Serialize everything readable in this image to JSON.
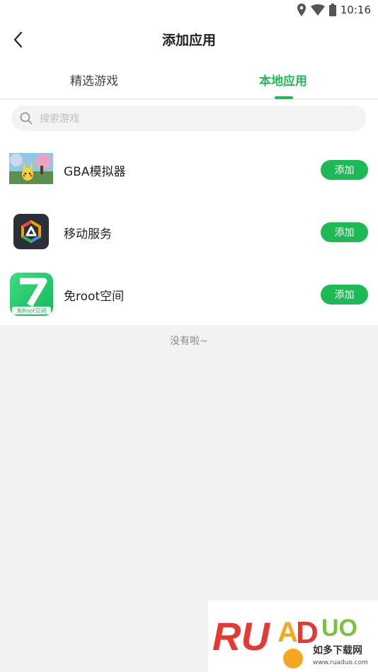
{
  "status_bar": {
    "time": "10:16"
  },
  "header": {
    "title": "添加应用"
  },
  "tabs": [
    {
      "label": "精选游戏",
      "active": false
    },
    {
      "label": "本地应用",
      "active": true
    }
  ],
  "search": {
    "placeholder": "搜索游戏"
  },
  "apps": [
    {
      "name": "GBA模拟器",
      "button": "添加",
      "icon": "gba-emulator-icon"
    },
    {
      "name": "移动服务",
      "button": "添加",
      "icon": "mobile-service-icon"
    },
    {
      "name": "免root空间",
      "button": "添加",
      "icon": "no-root-space-icon",
      "icon_text": "免Root空间"
    }
  ],
  "empty_message": "没有啦~",
  "watermark": {
    "logo": "RUANDUO",
    "cn": "如多下载网",
    "url": "www.ruaduo.com"
  },
  "colors": {
    "accent": "#1db954",
    "background": "#f2f2f2"
  }
}
